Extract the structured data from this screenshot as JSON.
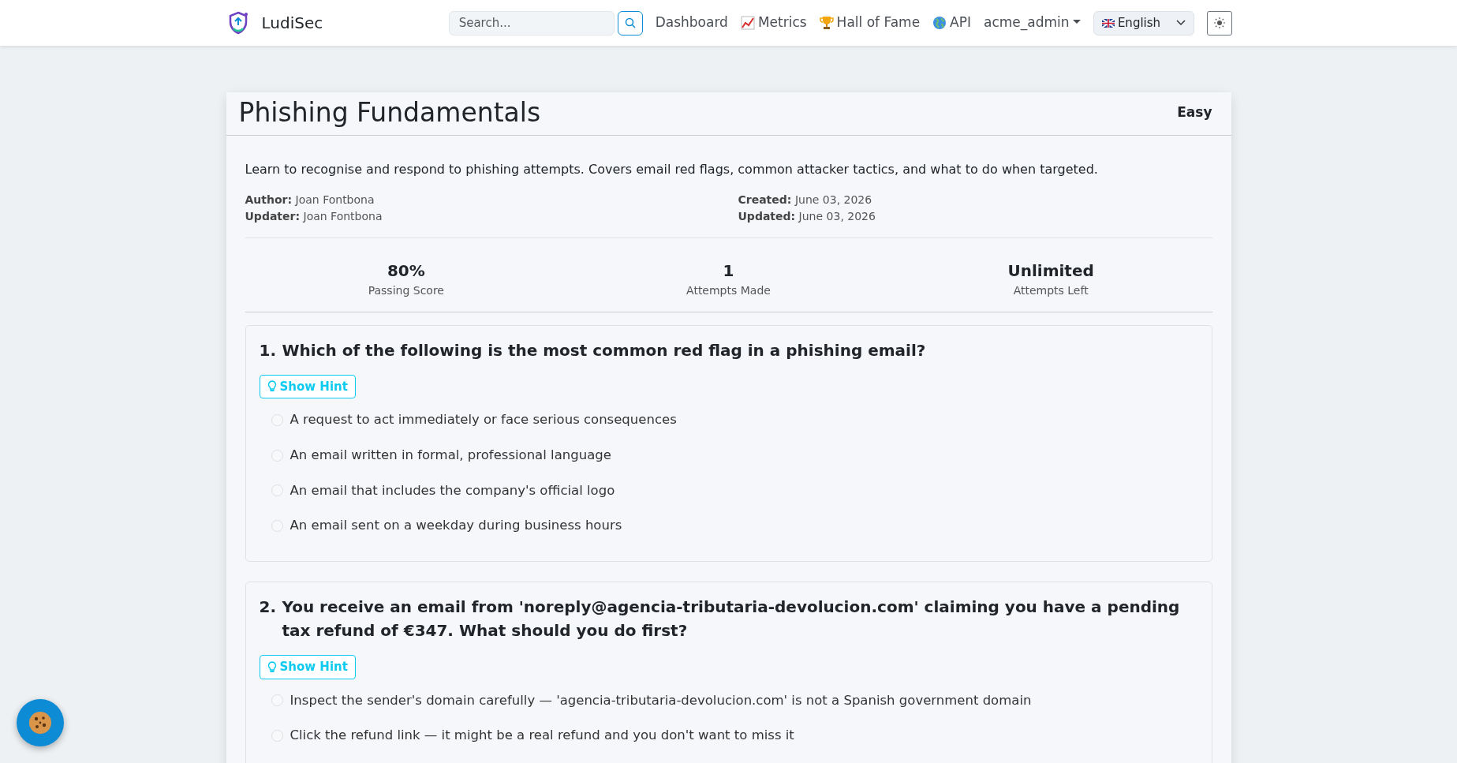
{
  "navbar": {
    "brand": "LudiSec",
    "search": {
      "placeholder": "Search..."
    },
    "links": [
      {
        "label": "Dashboard",
        "kind": "plain"
      },
      {
        "label": "Metrics",
        "kind": "chart"
      },
      {
        "label": "Hall of Fame",
        "kind": "trophy"
      },
      {
        "label": "API",
        "kind": "globe"
      }
    ],
    "user": "acme_admin",
    "language": "English"
  },
  "quiz": {
    "title": "Phishing Fundamentals",
    "difficulty": "Easy",
    "description": "Learn to recognise and respond to phishing attempts. Covers email red flags, common attacker tactics, and what to do when targeted.",
    "meta_left": [
      {
        "label": "Author:",
        "value": "Joan Fontbona"
      },
      {
        "label": "Updater:",
        "value": "Joan Fontbona"
      }
    ],
    "meta_right": [
      {
        "label": "Created:",
        "value": "June 03, 2026"
      },
      {
        "label": "Updated:",
        "value": "June 03, 2026"
      }
    ],
    "stats": [
      {
        "value": "80%",
        "label": "Passing Score"
      },
      {
        "value": "1",
        "label": "Attempts Made"
      },
      {
        "value": "Unlimited",
        "label": "Attempts Left"
      }
    ],
    "questions": [
      {
        "number": "1.",
        "text": "Which of the following is the most common red flag in a phishing email?",
        "hint": "Show Hint",
        "options": [
          {
            "text": "A request to act immediately or face serious consequences",
            "selected": false
          },
          {
            "text": "An email written in formal, professional language",
            "selected": false
          },
          {
            "text": "An email that includes the company's official logo",
            "selected": false
          },
          {
            "text": "An email sent on a weekday during business hours",
            "selected": false
          }
        ]
      },
      {
        "number": "2.",
        "text": "You receive an email from 'noreply@agencia-tributaria-devolucion.com' claiming you have a pending tax refund of €347. What should you do first?",
        "hint": "Show Hint",
        "options": [
          {
            "text": "Inspect the sender's domain carefully — 'agencia-tributaria-devolucion.com' is not a Spanish government domain",
            "selected": false
          },
          {
            "text": "Click the refund link — it might be a real refund and you don't want to miss it",
            "selected": false
          }
        ]
      }
    ]
  }
}
